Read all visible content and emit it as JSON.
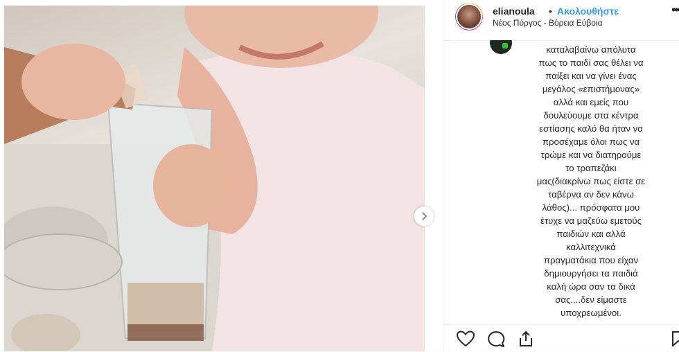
{
  "header": {
    "username": "elianoula",
    "separator": "•",
    "follow_label": "Ακολουθήστε",
    "location": "Νέος Πύργος - Βόρεια Εύβοια",
    "more_label": "•••"
  },
  "comment": {
    "text": "καταλαβαίνω απόλυτα\nπως το παιδί σας θέλει να\nπαίξει και να γίνει ένας\nμεγάλος «επιστήμονας»\nαλλά και εμείς που\nδουλεύουμε στα κέντρα\nεστίασης καλό θα ήταν να\nπροσέχαμε όλοι πως να\nτρώμε και να διατηρούμε\nτο τραπεζάκι\nμας(διακρίνω πως είστε σε\nταβέρνα αν δεν κάνω\nλάθος)... πρόσφατα μου\nέτυχε να μαζεύω εμετούς\nπαιδιών και αλλά\nκαλλιτεχνικά\nπραγματάκια που είχαν\nδημιουργήσει τα παιδιά\nκαλή ώρα σαν τα δικά\nσας....δεν είμαστε\nυποχρεωμένοι."
  },
  "icons": {
    "like": "heart-icon",
    "comment": "comment-icon",
    "share": "share-icon",
    "save": "bookmark-icon",
    "next": "chevron-right-icon"
  },
  "colors": {
    "accent": "#3897f0",
    "text": "#262626",
    "border": "#efefef"
  }
}
